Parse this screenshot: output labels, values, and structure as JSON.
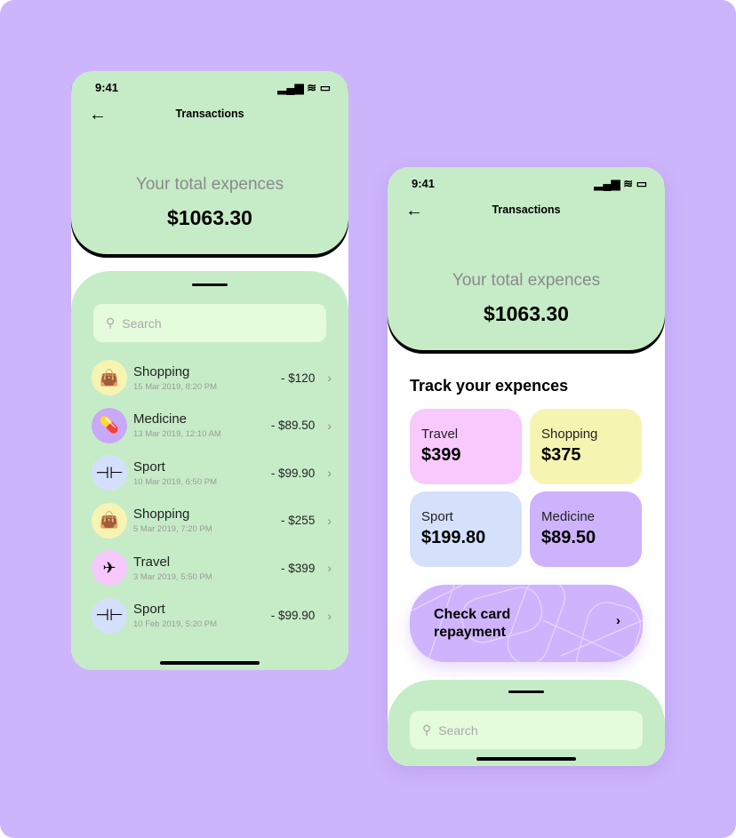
{
  "status_time": "9:41",
  "header": {
    "title": "Transactions",
    "label": "Your total expences",
    "total": "$1063.30"
  },
  "search": {
    "placeholder": "Search"
  },
  "transactions": [
    {
      "name": "Shopping",
      "date": "15 Mar 2019, 8:20 PM",
      "amount": "- $120",
      "icon": "shopping-bag-icon",
      "color": "#f7f4b2"
    },
    {
      "name": "Medicine",
      "date": "13 Mar 2019, 12:10 AM",
      "amount": "- $89.50",
      "icon": "pill-icon",
      "color": "#c9a8f7"
    },
    {
      "name": "Sport",
      "date": "10 Mar 2019, 6:50 PM",
      "amount": "- $99.90",
      "icon": "dumbbell-icon",
      "color": "#d4e0fb"
    },
    {
      "name": "Shopping",
      "date": "5 Mar 2019, 7:20 PM",
      "amount": "- $255",
      "icon": "shopping-bag-icon",
      "color": "#f7f4b2"
    },
    {
      "name": "Travel",
      "date": "3 Mar 2019, 5:50 PM",
      "amount": "- $399",
      "icon": "airplane-icon",
      "color": "#f6c8fb"
    },
    {
      "name": "Sport",
      "date": "10 Feb 2019, 5:20 PM",
      "amount": "- $99.90",
      "icon": "dumbbell-icon",
      "color": "#d4e0fb"
    }
  ],
  "track": {
    "title": "Track your expences",
    "categories": [
      {
        "name": "Travel",
        "value": "$399",
        "color": "#f7c9fc"
      },
      {
        "name": "Shopping",
        "value": "$375",
        "color": "#f6f4b1"
      },
      {
        "name": "Sport",
        "value": "$199.80",
        "color": "#d5e1fb"
      },
      {
        "name": "Medicine",
        "value": "$89.50",
        "color": "#cdb3fb"
      }
    ]
  },
  "card": {
    "label": "Check card repayment"
  }
}
